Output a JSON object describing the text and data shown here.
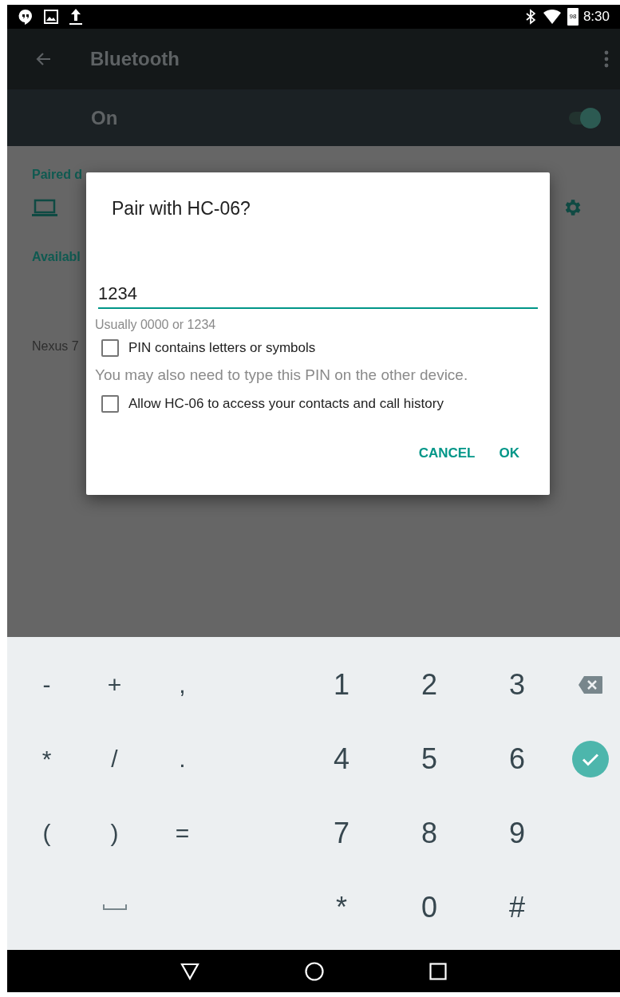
{
  "status_bar": {
    "battery": "98",
    "time": "8:30"
  },
  "toolbar": {
    "title": "Bluetooth"
  },
  "master_switch": {
    "label": "On",
    "on": true
  },
  "background_list": {
    "paired_header": "Paired d",
    "available_header": "Availabl",
    "device": "Nexus 7"
  },
  "dialog": {
    "title": "Pair with HC-06?",
    "pin_field": {
      "value": "1234"
    },
    "hint": "Usually 0000 or 1234",
    "options": [
      {
        "kind": "checkbox",
        "label": "PIN contains letters or symbols",
        "checked": false
      },
      {
        "kind": "note",
        "label": "You may also need to type this PIN on the other device."
      },
      {
        "kind": "checkbox",
        "label": "Allow HC-06 to access your contacts and call history",
        "checked": false
      }
    ],
    "buttons": [
      "CANCEL",
      "OK"
    ]
  },
  "keyboard": {
    "rows": [
      {
        "keys": [
          {
            "kind": "char",
            "label": "-"
          },
          {
            "kind": "char",
            "label": "+"
          },
          {
            "kind": "char",
            "label": ","
          },
          {
            "kind": "char",
            "label": "1"
          },
          {
            "kind": "char",
            "label": "2"
          },
          {
            "kind": "char",
            "label": "3"
          },
          {
            "kind": "backspace"
          }
        ]
      },
      {
        "keys": [
          {
            "kind": "char",
            "label": "*"
          },
          {
            "kind": "char",
            "label": "/"
          },
          {
            "kind": "char",
            "label": "."
          },
          {
            "kind": "char",
            "label": "4"
          },
          {
            "kind": "char",
            "label": "5"
          },
          {
            "kind": "char",
            "label": "6"
          },
          {
            "kind": "done"
          }
        ]
      },
      {
        "keys": [
          {
            "kind": "char",
            "label": "("
          },
          {
            "kind": "char",
            "label": ")"
          },
          {
            "kind": "char",
            "label": "="
          },
          {
            "kind": "char",
            "label": "7"
          },
          {
            "kind": "char",
            "label": "8"
          },
          {
            "kind": "char",
            "label": "9"
          },
          {
            "kind": "blank"
          }
        ]
      },
      {
        "keys": [
          {
            "kind": "blank"
          },
          {
            "kind": "space"
          },
          {
            "kind": "blank"
          },
          {
            "kind": "char",
            "label": "*"
          },
          {
            "kind": "char",
            "label": "0"
          },
          {
            "kind": "char",
            "label": "#"
          },
          {
            "kind": "blank"
          }
        ]
      }
    ]
  }
}
